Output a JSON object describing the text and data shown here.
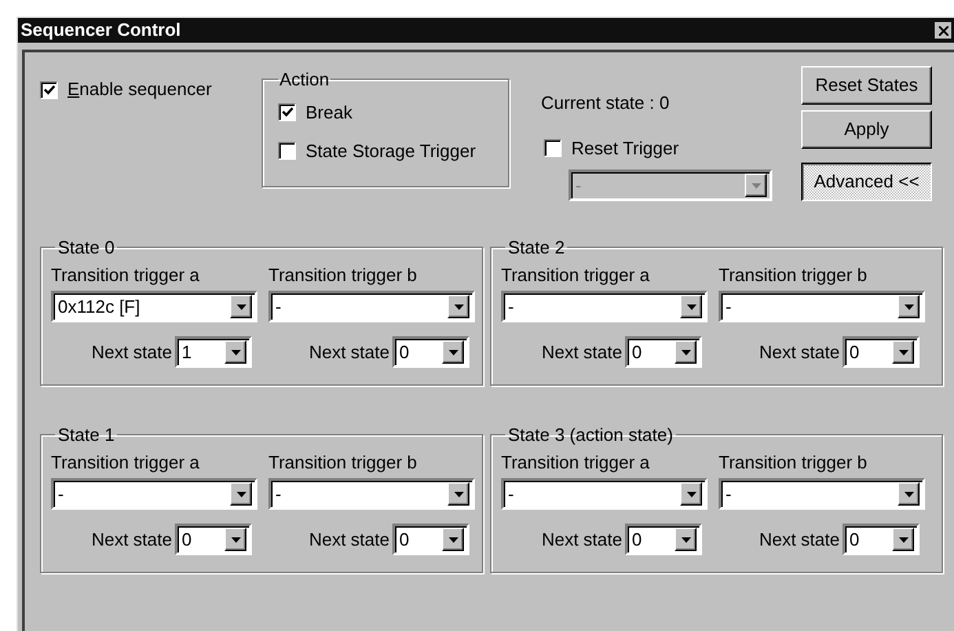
{
  "window": {
    "title": "Sequencer Control"
  },
  "enable_sequencer": {
    "label": "Enable sequencer",
    "mnemonic_underlined": true,
    "checked": true
  },
  "action": {
    "title": "Action",
    "options": [
      {
        "label": "Break",
        "checked": true
      },
      {
        "label": "State Storage Trigger",
        "checked": false
      }
    ]
  },
  "current_state": "Current state : 0",
  "reset_trigger": {
    "label": "Reset Trigger",
    "checked": false,
    "dropdown": {
      "value": "-",
      "disabled": true
    }
  },
  "buttons": [
    {
      "label": "Reset States",
      "pressed": false
    },
    {
      "label": "Apply",
      "pressed": false
    },
    {
      "label": "Advanced <<",
      "pressed": true
    }
  ],
  "states": [
    {
      "title": "State 0",
      "triggers": [
        {
          "label": "Transition trigger a",
          "value": "0x112c [F]",
          "next_label": "Next state",
          "next_value": "1"
        },
        {
          "label": "Transition trigger b",
          "value": "-",
          "next_label": "Next state",
          "next_value": "0"
        }
      ]
    },
    {
      "title": "State 2",
      "triggers": [
        {
          "label": "Transition trigger a",
          "value": "-",
          "next_label": "Next state",
          "next_value": "0"
        },
        {
          "label": "Transition trigger b",
          "value": "-",
          "next_label": "Next state",
          "next_value": "0"
        }
      ]
    },
    {
      "title": "State 1",
      "triggers": [
        {
          "label": "Transition trigger a",
          "value": "-",
          "next_label": "Next state",
          "next_value": "0"
        },
        {
          "label": "Transition trigger b",
          "value": "-",
          "next_label": "Next state",
          "next_value": "0"
        }
      ]
    },
    {
      "title": "State 3 (action state)",
      "triggers": [
        {
          "label": "Transition trigger a",
          "value": "-",
          "next_label": "Next state",
          "next_value": "0"
        },
        {
          "label": "Transition trigger b",
          "value": "-",
          "next_label": "Next state",
          "next_value": "0"
        }
      ]
    }
  ]
}
